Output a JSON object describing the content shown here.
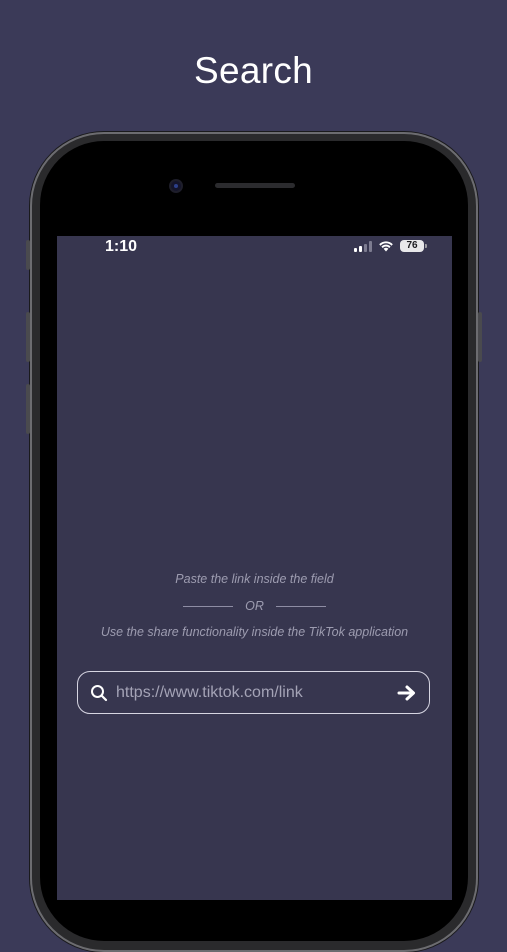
{
  "header": {
    "title": "Search"
  },
  "status_bar": {
    "time": "1:10",
    "battery_level": "76",
    "signal_icon": "cellular-signal-icon",
    "wifi_icon": "wifi-icon"
  },
  "main": {
    "hint_paste": "Paste the link inside the field",
    "or_label": "OR",
    "hint_share": "Use the share functionality inside the TikTok application"
  },
  "search": {
    "placeholder": "https://www.tiktok.com/link",
    "value": "",
    "leading_icon": "search-icon",
    "submit_icon": "arrow-right-icon"
  },
  "colors": {
    "page_background": "#3b3a58",
    "screen_background": "#37364f",
    "text_primary": "#ffffff",
    "text_muted": "#9d9cb0"
  }
}
